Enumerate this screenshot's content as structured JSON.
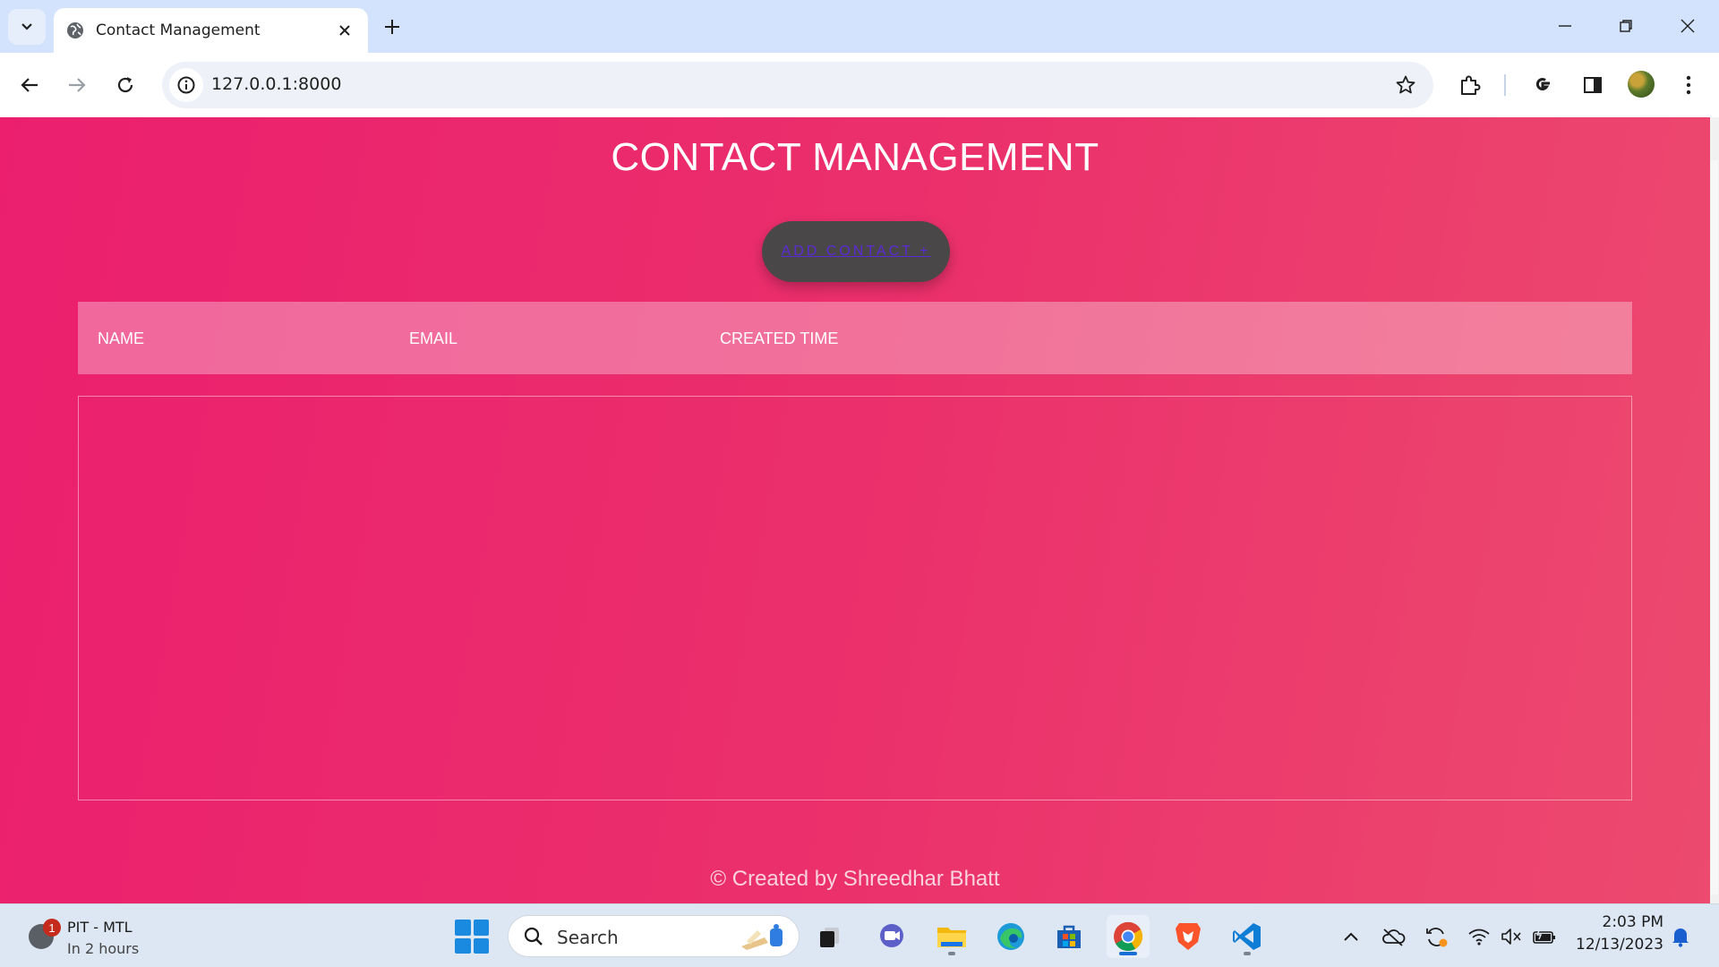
{
  "browser": {
    "tab_title": "Contact Management",
    "url": "127.0.0.1:8000"
  },
  "page": {
    "title": "CONTACT MANAGEMENT",
    "add_button": "ADD CONTACT +",
    "table": {
      "columns": [
        "NAME",
        "EMAIL",
        "CREATED TIME"
      ],
      "rows": []
    },
    "footer": "© Created by Shreedhar Bhatt"
  },
  "taskbar": {
    "weather_badge": "1",
    "weather_title": "PIT - MTL",
    "weather_sub": "In 2 hours",
    "search_label": "Search",
    "apps": [
      "task-view",
      "teams",
      "file-explorer",
      "edge",
      "microsoft-store",
      "chrome",
      "brave",
      "vscode"
    ],
    "time": "2:03 PM",
    "date": "12/13/2023"
  },
  "colors": {
    "page_gradient_start": "#eb1f6e",
    "page_gradient_end": "#ec4a6e",
    "button_bg": "#4a4748",
    "button_text": "#5b2bd6"
  }
}
